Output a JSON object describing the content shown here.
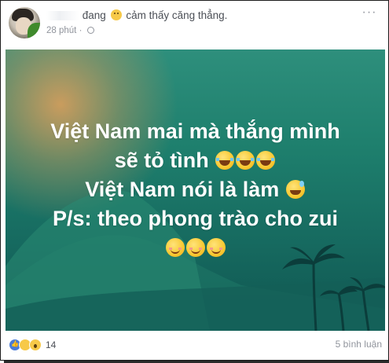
{
  "post": {
    "status_text": "đang",
    "feeling_text": "cảm thấy căng thẳng.",
    "time": "28 phút",
    "privacy_icon": "globe-icon",
    "menu_icon": "more-dots-icon"
  },
  "card": {
    "line1": "Việt Nam mai mà thắng mình",
    "line2": "sẽ tỏ tình",
    "line3": "Việt Nam nói là làm",
    "line4": "P/s: theo phong trào cho zui",
    "colors": {
      "top": "#2e8f7c",
      "bottom": "#0f5550",
      "glow": "#e6a05a"
    }
  },
  "footer": {
    "reaction_count": "14",
    "reaction_icons": [
      "like-icon",
      "haha-icon",
      "wow-icon"
    ],
    "comments": "5 bình luận"
  }
}
